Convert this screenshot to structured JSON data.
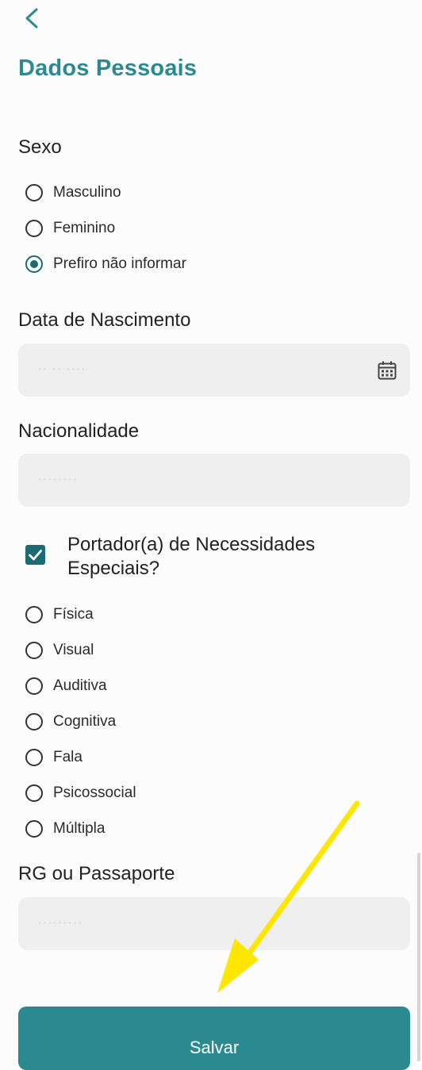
{
  "header": {
    "back_icon": "chevron-left-icon",
    "title": "Dados Pessoais"
  },
  "sexo": {
    "label": "Sexo",
    "options": [
      {
        "label": "Masculino",
        "checked": false
      },
      {
        "label": "Feminino",
        "checked": false
      },
      {
        "label": "Prefiro não informar",
        "checked": true
      }
    ]
  },
  "birth": {
    "label": "Data de Nascimento",
    "value": "·· ·· ····",
    "icon": "calendar-icon"
  },
  "nationality": {
    "label": "Nacionalidade",
    "value": "········"
  },
  "special_needs": {
    "label": "Portador(a) de Necessidades Especiais?",
    "checked": true,
    "options": [
      {
        "label": "Física",
        "checked": false
      },
      {
        "label": "Visual",
        "checked": false
      },
      {
        "label": "Auditiva",
        "checked": false
      },
      {
        "label": "Cognitiva",
        "checked": false
      },
      {
        "label": "Fala",
        "checked": false
      },
      {
        "label": "Psicossocial",
        "checked": false
      },
      {
        "label": "Múltipla",
        "checked": false
      }
    ]
  },
  "document": {
    "label": "RG ou Passaporte",
    "value": "·········"
  },
  "actions": {
    "save_label": "Salvar"
  },
  "colors": {
    "accent": "#2b8a90",
    "accent_dark": "#1b6b73",
    "field_bg": "#efefef",
    "annotation_arrow": "#ffe600"
  }
}
